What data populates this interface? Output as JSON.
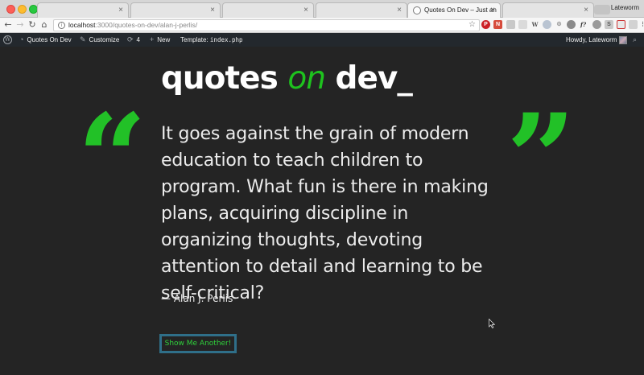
{
  "browser": {
    "tabs": [
      {
        "title": ""
      },
      {
        "title": ""
      },
      {
        "title": ""
      },
      {
        "title": ""
      },
      {
        "title": "Quotes On Dev – Just anot"
      },
      {
        "title": ""
      }
    ],
    "profile_name": "Lateworm",
    "url_host": "localhost",
    "url_path": ":3000/quotes-on-dev/alan-j-perlis/"
  },
  "admin_bar": {
    "site_name": "Quotes On Dev",
    "customize": "Customize",
    "updates_count": "4",
    "new_label": "New",
    "template_label": "Template:",
    "template_file": "index.php",
    "howdy": "Howdy, Lateworm"
  },
  "site": {
    "title_part1": "quotes",
    "title_part2": "on",
    "title_part3": "dev_",
    "accent_color": "#1ec21e"
  },
  "quote": {
    "open_mark": "“",
    "close_mark": "”",
    "text": "It goes against the grain of modern education to teach children to program. What fun is there in making plans, acquiring discipline in organizing thoughts, devoting attention to detail and learning to be self-critical?",
    "author": "— Alan J. Perlis"
  },
  "button": {
    "label": "Show Me Another!",
    "border_color": "#2f6f89",
    "text_color": "#2fd03b"
  }
}
